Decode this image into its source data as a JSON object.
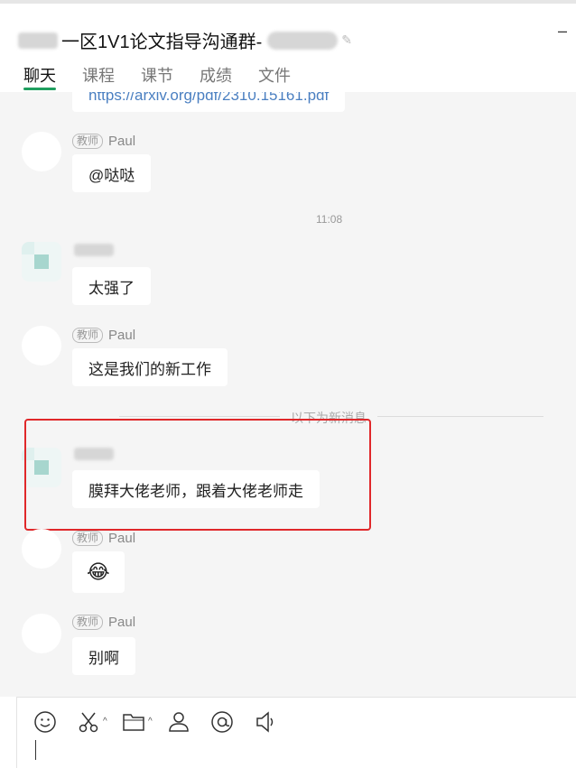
{
  "window": {
    "title": "一区1V1论文指导沟通群-",
    "minimize_glyph": "–"
  },
  "tabs": [
    {
      "label": "聊天",
      "active": true
    },
    {
      "label": "课程",
      "active": false
    },
    {
      "label": "课节",
      "active": false
    },
    {
      "label": "成绩",
      "active": false
    },
    {
      "label": "文件",
      "active": false
    }
  ],
  "chat": {
    "link_message": "https://arxiv.org/pdf/2310.15161.pdf",
    "messages": [
      {
        "role": "教师",
        "sender": "Paul",
        "text": "@哒哒"
      },
      {
        "role": "",
        "sender": "",
        "text": "太强了"
      },
      {
        "role": "教师",
        "sender": "Paul",
        "text": "这是我们的新工作"
      },
      {
        "role": "",
        "sender": "",
        "text": "膜拜大佬老师，跟着大佬老师走"
      },
      {
        "role": "教师",
        "sender": "Paul",
        "text": "😂"
      },
      {
        "role": "教师",
        "sender": "Paul",
        "text": "别啊"
      }
    ],
    "timestamp": "11:08",
    "new_messages_divider": "以下为新消息"
  },
  "toolbar": {
    "icons": [
      "emoji-icon",
      "scissors-icon",
      "folder-icon",
      "contact-card-icon",
      "at-mention-icon",
      "speaker-icon"
    ],
    "caret": "^"
  }
}
